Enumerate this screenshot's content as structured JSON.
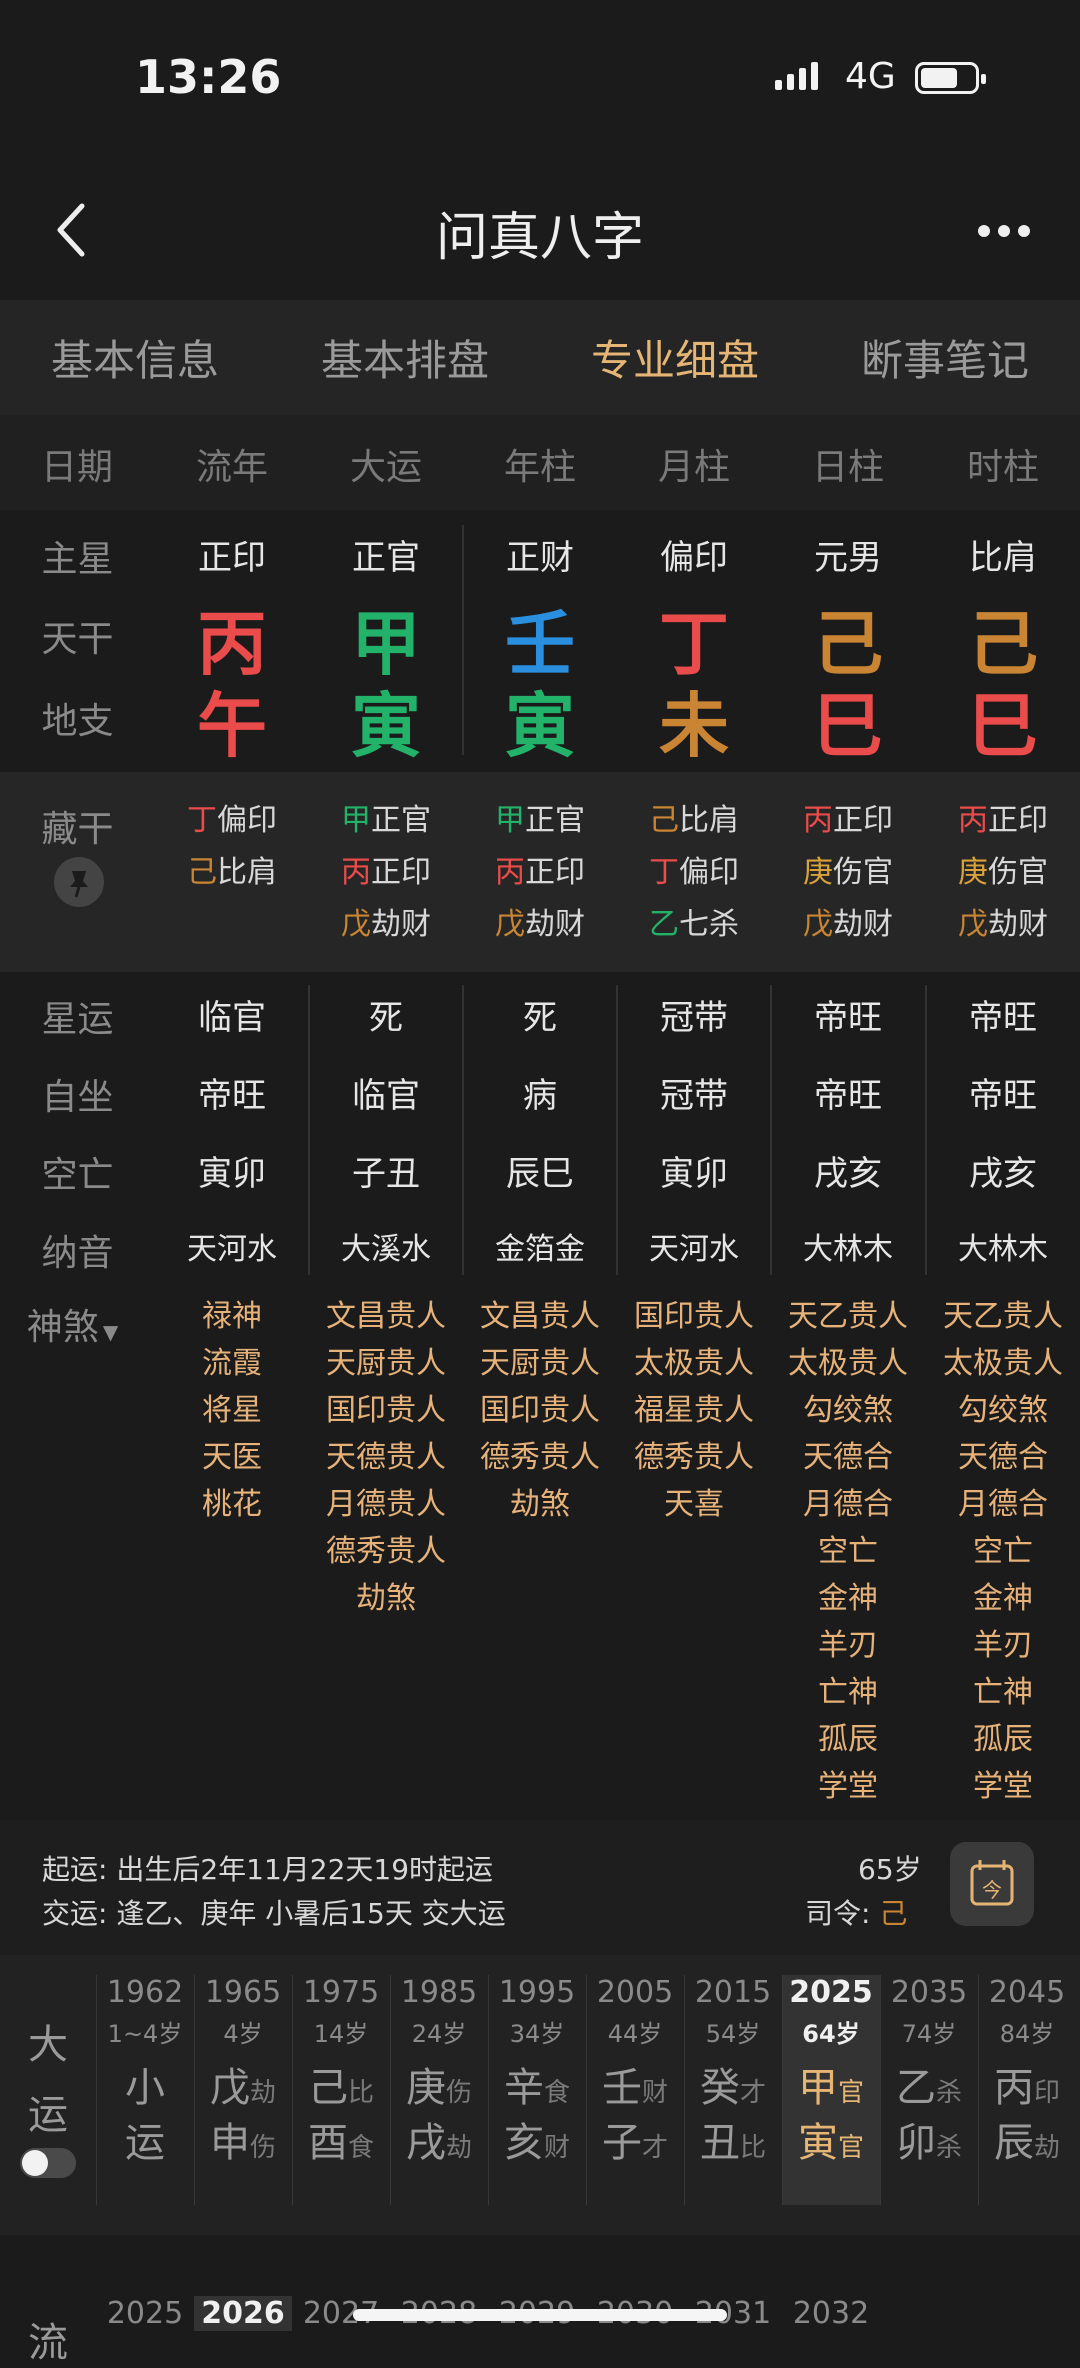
{
  "status": {
    "time": "13:26",
    "network": "4G"
  },
  "nav": {
    "title": "问真八字"
  },
  "tabs": [
    "基本信息",
    "基本排盘",
    "专业细盘",
    "断事笔记"
  ],
  "active_tab": 2,
  "columns": [
    "日期",
    "流年",
    "大运",
    "年柱",
    "月柱",
    "日柱",
    "时柱"
  ],
  "row_labels": {
    "main_star": "主星",
    "stem": "天干",
    "branch": "地支",
    "hidden": "藏干",
    "xingyun": "星运",
    "zizuo": "自坐",
    "kongwang": "空亡",
    "nayin": "纳音",
    "shensha": "神煞"
  },
  "main_star": [
    "正印",
    "正官",
    "正财",
    "偏印",
    "元男",
    "比肩"
  ],
  "stems": [
    {
      "char": "丙",
      "color": "#ea4b4b"
    },
    {
      "char": "甲",
      "color": "#23b26a"
    },
    {
      "char": "壬",
      "color": "#2a8fdf"
    },
    {
      "char": "丁",
      "color": "#ea4b4b"
    },
    {
      "char": "己",
      "color": "#c98533"
    },
    {
      "char": "己",
      "color": "#c98533"
    }
  ],
  "branches": [
    {
      "char": "午",
      "color": "#ea4b4b"
    },
    {
      "char": "寅",
      "color": "#23b26a"
    },
    {
      "char": "寅",
      "color": "#23b26a"
    },
    {
      "char": "未",
      "color": "#c98533"
    },
    {
      "char": "巳",
      "color": "#ea4b4b"
    },
    {
      "char": "巳",
      "color": "#ea4b4b"
    }
  ],
  "hidden": [
    [
      {
        "c": "丁",
        "col": "#ea4b4b",
        "t": "偏印"
      },
      {
        "c": "己",
        "col": "#c98533",
        "t": "比肩"
      }
    ],
    [
      {
        "c": "甲",
        "col": "#23b26a",
        "t": "正官"
      },
      {
        "c": "丙",
        "col": "#ea4b4b",
        "t": "正印"
      },
      {
        "c": "戊",
        "col": "#c98533",
        "t": "劫财"
      }
    ],
    [
      {
        "c": "甲",
        "col": "#23b26a",
        "t": "正官"
      },
      {
        "c": "丙",
        "col": "#ea4b4b",
        "t": "正印"
      },
      {
        "c": "戊",
        "col": "#c98533",
        "t": "劫财"
      }
    ],
    [
      {
        "c": "己",
        "col": "#c98533",
        "t": "比肩"
      },
      {
        "c": "丁",
        "col": "#ea4b4b",
        "t": "偏印"
      },
      {
        "c": "乙",
        "col": "#23b26a",
        "t": "七杀"
      }
    ],
    [
      {
        "c": "丙",
        "col": "#ea4b4b",
        "t": "正印"
      },
      {
        "c": "庚",
        "col": "#d9a23a",
        "t": "伤官"
      },
      {
        "c": "戊",
        "col": "#c98533",
        "t": "劫财"
      }
    ],
    [
      {
        "c": "丙",
        "col": "#ea4b4b",
        "t": "正印"
      },
      {
        "c": "庚",
        "col": "#d9a23a",
        "t": "伤官"
      },
      {
        "c": "戊",
        "col": "#c98533",
        "t": "劫财"
      }
    ]
  ],
  "xingyun": [
    "临官",
    "死",
    "死",
    "冠带",
    "帝旺",
    "帝旺"
  ],
  "zizuo": [
    "帝旺",
    "临官",
    "病",
    "冠带",
    "帝旺",
    "帝旺"
  ],
  "kongwang": [
    "寅卯",
    "子丑",
    "辰巳",
    "寅卯",
    "戌亥",
    "戌亥"
  ],
  "nayin": [
    "天河水",
    "大溪水",
    "金箔金",
    "天河水",
    "大林木",
    "大林木"
  ],
  "shensha": [
    [
      "禄神",
      "流霞",
      "将星",
      "天医",
      "桃花"
    ],
    [
      "文昌贵人",
      "天厨贵人",
      "国印贵人",
      "天德贵人",
      "月德贵人",
      "德秀贵人",
      "劫煞"
    ],
    [
      "文昌贵人",
      "天厨贵人",
      "国印贵人",
      "德秀贵人",
      "劫煞"
    ],
    [
      "国印贵人",
      "太极贵人",
      "福星贵人",
      "德秀贵人",
      "天喜"
    ],
    [
      "天乙贵人",
      "太极贵人",
      "勾绞煞",
      "天德合",
      "月德合",
      "空亡",
      "金神",
      "羊刃",
      "亡神",
      "孤辰",
      "学堂"
    ],
    [
      "天乙贵人",
      "太极贵人",
      "勾绞煞",
      "天德合",
      "月德合",
      "空亡",
      "金神",
      "羊刃",
      "亡神",
      "孤辰",
      "学堂"
    ]
  ],
  "info": {
    "qiyun_label": "起运:",
    "qiyun_text": "出生后2年11月22天19时起运",
    "jiaoyun_label": "交运:",
    "jiaoyun_text": "逢乙、庚年 小暑后15天 交大运",
    "age": "65岁",
    "siling_label": "司令:",
    "siling_value": "己"
  },
  "dayun": {
    "label_top": "大",
    "label_bottom": "运",
    "items": [
      {
        "year": "1962",
        "age": "1~4岁",
        "g1": "小",
        "s1": "",
        "g2": "运",
        "s2": ""
      },
      {
        "year": "1965",
        "age": "4岁",
        "g1": "戊",
        "s1": "劫",
        "g2": "申",
        "s2": "伤"
      },
      {
        "year": "1975",
        "age": "14岁",
        "g1": "己",
        "s1": "比",
        "g2": "酉",
        "s2": "食"
      },
      {
        "year": "1985",
        "age": "24岁",
        "g1": "庚",
        "s1": "伤",
        "g2": "戌",
        "s2": "劫"
      },
      {
        "year": "1995",
        "age": "34岁",
        "g1": "辛",
        "s1": "食",
        "g2": "亥",
        "s2": "财"
      },
      {
        "year": "2005",
        "age": "44岁",
        "g1": "壬",
        "s1": "财",
        "g2": "子",
        "s2": "才"
      },
      {
        "year": "2015",
        "age": "54岁",
        "g1": "癸",
        "s1": "才",
        "g2": "丑",
        "s2": "比"
      },
      {
        "year": "2025",
        "age": "64岁",
        "g1": "甲",
        "s1": "官",
        "g2": "寅",
        "s2": "官"
      },
      {
        "year": "2035",
        "age": "74岁",
        "g1": "乙",
        "s1": "杀",
        "g2": "卯",
        "s2": "杀"
      },
      {
        "year": "2045",
        "age": "84岁",
        "g1": "丙",
        "s1": "印",
        "g2": "辰",
        "s2": "劫"
      }
    ],
    "active_index": 7
  },
  "liunian": {
    "label": "流",
    "years": [
      "2025",
      "2026",
      "2027",
      "2028",
      "2029",
      "2030",
      "2031",
      "2032"
    ],
    "active_index": 1
  }
}
